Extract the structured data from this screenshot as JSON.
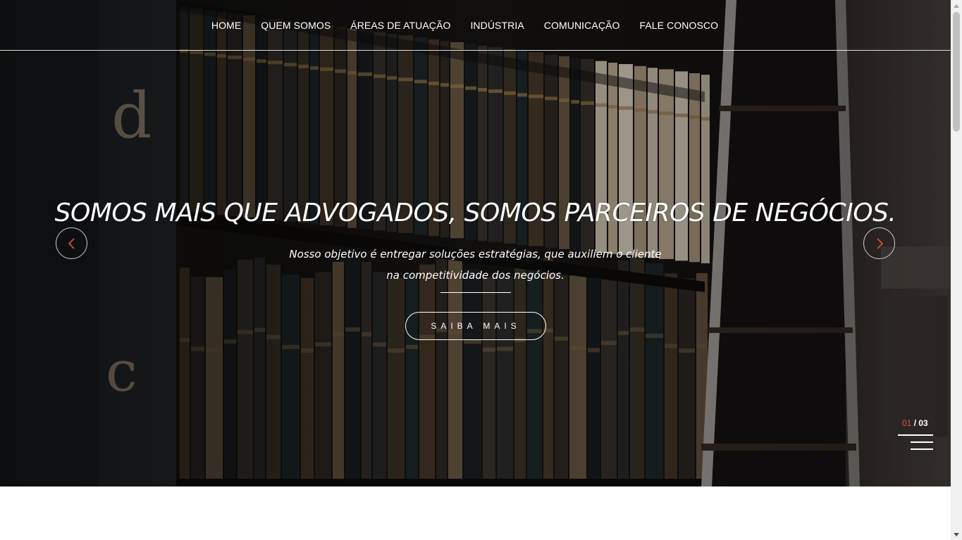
{
  "nav": {
    "items": [
      {
        "label": "HOME"
      },
      {
        "label": "QUEM SOMOS"
      },
      {
        "label": "ÁREAS DE ATUAÇÃO"
      },
      {
        "label": "INDÚSTRIA"
      },
      {
        "label": "COMUNICAÇÃO"
      },
      {
        "label": "FALE CONOSCO"
      }
    ]
  },
  "hero": {
    "headline": "SOMOS MAIS QUE ADVOGADOS, SOMOS PARCEIROS DE NEGÓCIOS.",
    "subtitle_line1": "Nosso objetivo é entregar soluções estratégias, que auxiliem o cliente",
    "subtitle_line2": "na competitividade dos negócios.",
    "cta_label": "SAIBA MAIS",
    "prev_icon": "chevron-left-icon",
    "next_icon": "chevron-right-icon",
    "arrow_color": "#e0533b"
  },
  "slider": {
    "current": "01",
    "separator": " / ",
    "total": "03"
  },
  "colors": {
    "accent": "#e0533b",
    "text": "#ffffff"
  }
}
